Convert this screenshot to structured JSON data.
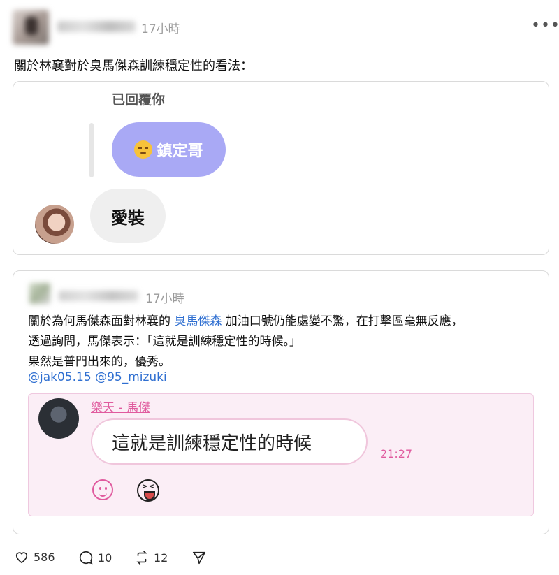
{
  "post": {
    "time": "17小時",
    "text": "關於林襄對於臭馬傑森訓練穩定性的看法：",
    "more_icon": "more-horizontal-icon"
  },
  "reply_card": {
    "replied_label": "已回覆你",
    "purple_bubble": {
      "emoji": "pensive-face-icon",
      "text": "鎮定哥"
    },
    "grey_bubble": "愛裝"
  },
  "quoted_post": {
    "time": "17小時",
    "line1_before": "關於為何馬傑森面對林襄的 ",
    "line1_link": "臭馬傑森",
    "line1_after": " 加油口號仍能處變不驚，在打擊區毫無反應，",
    "line2": "透過詢問，馬傑表示：「這就是訓練穩定性的時候。」",
    "line3": "果然是普門出來的，優秀。",
    "mention1": "@jak05.15",
    "mention2": "@95_mizuki",
    "embed": {
      "sender_name": "樂天 - 馬傑",
      "message": "這就是訓練穩定性的時候",
      "time": "21:27",
      "icons": [
        "smile-icon",
        "laughing-face-icon"
      ]
    }
  },
  "actions": {
    "likes": "586",
    "comments": "10",
    "reposts": "12"
  },
  "colors": {
    "accent_pink": "#e05a9e",
    "link_blue": "#2f6fd1",
    "purple_bubble": "#a9a9f5"
  }
}
